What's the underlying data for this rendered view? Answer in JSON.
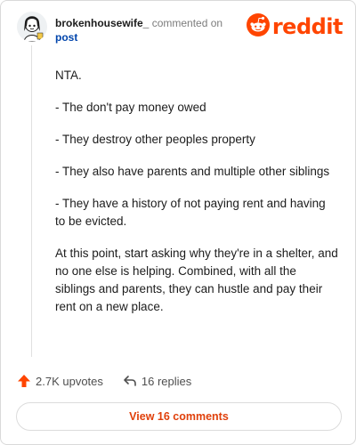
{
  "header": {
    "username": "brokenhousewife_",
    "action_text": "commented on",
    "post_link": "post",
    "logo_text": "reddit",
    "logo_icon": "reddit-snoo-icon",
    "avatar_icon": "snoo-avatar-icon"
  },
  "comment": {
    "paragraphs": [
      "NTA.",
      "- The don't pay money owed",
      "- They destroy other peoples property",
      "- They also have parents and multiple other siblings",
      "- They have a history of not paying rent and having to be evicted.",
      "At this point, start asking why they're in a shelter, and no one else is helping. Combined, with all the siblings and parents, they can hustle and pay their rent on a new place."
    ]
  },
  "actions": {
    "upvotes_label": "2.7K upvotes",
    "upvote_icon": "upvote-arrow-icon",
    "replies_label": "16 replies",
    "reply_icon": "reply-arrow-icon"
  },
  "footer": {
    "view_comments_label": "View 16 comments"
  },
  "colors": {
    "brand": "#ff4500",
    "link": "#0045ac",
    "button_text": "#e0400b"
  }
}
